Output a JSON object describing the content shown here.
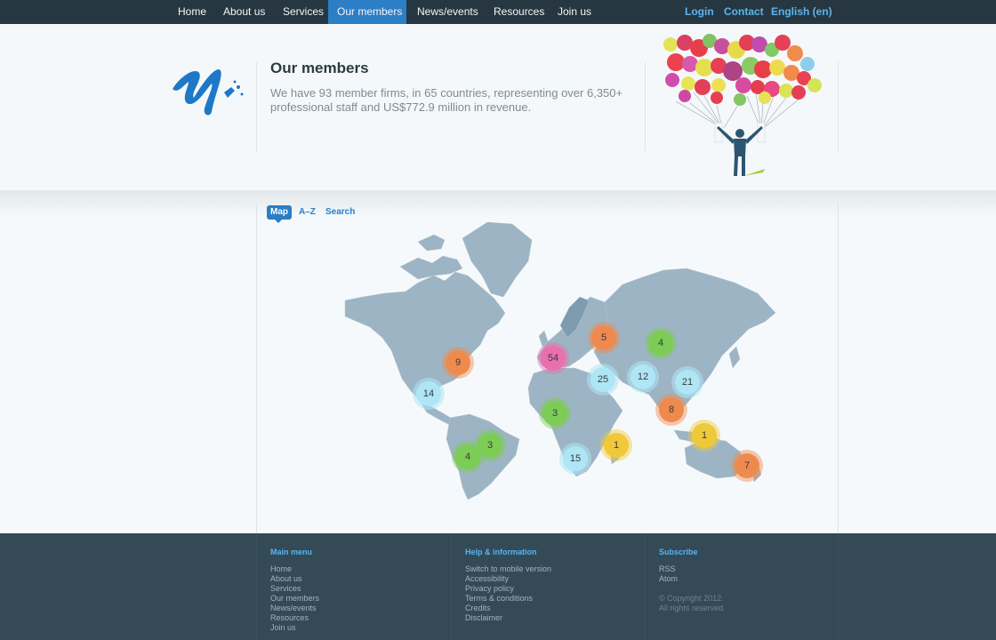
{
  "nav": {
    "items": [
      {
        "label": "Home"
      },
      {
        "label": "About us"
      },
      {
        "label": "Services"
      },
      {
        "label": "Our members"
      },
      {
        "label": "News/events"
      },
      {
        "label": "Resources"
      },
      {
        "label": "Join us"
      }
    ],
    "active": "Our members",
    "right": {
      "login": "Login",
      "contact": "Contact",
      "language": "English (en)"
    }
  },
  "header": {
    "title": "Our members",
    "description": "We have 93 member firms, in 65 countries, representing over 6,350+ professional staff and US$772.9 million in revenue."
  },
  "tabs": [
    {
      "label": "Map",
      "active": true
    },
    {
      "label": "A–Z",
      "active": false
    },
    {
      "label": "Search",
      "active": false
    }
  ],
  "map": {
    "markers": [
      {
        "count": "9",
        "color": "orange"
      },
      {
        "count": "14",
        "color": "cyan"
      },
      {
        "count": "3",
        "color": "green"
      },
      {
        "count": "4",
        "color": "green"
      },
      {
        "count": "54",
        "color": "pink"
      },
      {
        "count": "5",
        "color": "orange"
      },
      {
        "count": "4",
        "color": "green"
      },
      {
        "count": "25",
        "color": "cyan"
      },
      {
        "count": "12",
        "color": "cyan"
      },
      {
        "count": "21",
        "color": "cyan"
      },
      {
        "count": "3",
        "color": "green"
      },
      {
        "count": "8",
        "color": "orange"
      },
      {
        "count": "1",
        "color": "yellow"
      },
      {
        "count": "1",
        "color": "yellow"
      },
      {
        "count": "15",
        "color": "cyan"
      },
      {
        "count": "7",
        "color": "orange"
      }
    ]
  },
  "footer": {
    "main_menu": {
      "heading": "Main menu",
      "links": [
        "Home",
        "About us",
        "Services",
        "Our members",
        "News/events",
        "Resources",
        "Join us"
      ]
    },
    "help": {
      "heading": "Help & information",
      "links": [
        "Switch to mobile version",
        "Accessibility",
        "Privacy policy",
        "Terms & conditions",
        "Credits",
        "Disclaimer"
      ]
    },
    "subscribe": {
      "heading": "Subscribe",
      "links": [
        "RSS",
        "Atom"
      ],
      "copyright": "© Copyright 2012.",
      "rights": "All rights reserved."
    }
  },
  "colors": {
    "nav_bg": "#273741",
    "accent": "#2c7ec6",
    "footer_bg": "#344a56",
    "map_land": "#9db4c4"
  },
  "icons": {
    "logo": "brush-stroke-logo",
    "illustration": "man-with-balloons"
  }
}
